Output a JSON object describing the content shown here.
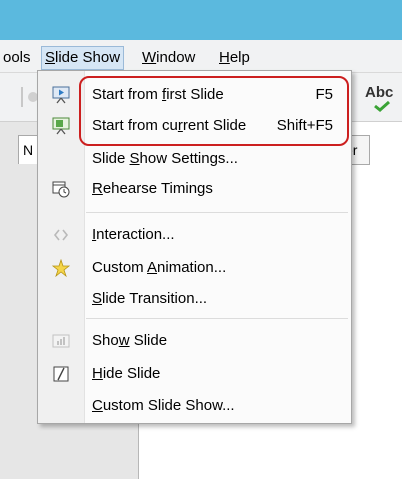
{
  "menubar": {
    "items": [
      {
        "label": "ools"
      },
      {
        "label": "Slide Show",
        "underline_index": 0
      },
      {
        "label": "Window",
        "underline_index": 0
      },
      {
        "label": "Help",
        "underline_index": 0
      }
    ]
  },
  "toolbar": {
    "spellcheck_label": "Abc"
  },
  "sidebar": {
    "tab_label": "N"
  },
  "editor": {
    "tab_label": "er"
  },
  "menu": {
    "items": [
      {
        "label": "Start from first Slide",
        "u": 11,
        "shortcut": "F5",
        "icon": "slideshow-play-icon",
        "enabled": true
      },
      {
        "label": "Start from current Slide",
        "u": 13,
        "shortcut": "Shift+F5",
        "icon": "slideshow-current-icon",
        "enabled": true
      },
      {
        "label": "Slide Show Settings...",
        "u": 6,
        "shortcut": "",
        "icon": "",
        "enabled": true
      },
      {
        "label": "Rehearse Timings",
        "u": 0,
        "shortcut": "",
        "icon": "rehearse-timings-icon",
        "enabled": true
      },
      {
        "label": "Interaction...",
        "u": 0,
        "shortcut": "",
        "icon": "interaction-icon",
        "enabled": false
      },
      {
        "label": "Custom Animation...",
        "u": 7,
        "shortcut": "",
        "icon": "custom-animation-icon",
        "enabled": true
      },
      {
        "label": "Slide Transition...",
        "u": 0,
        "shortcut": "",
        "icon": "",
        "enabled": true
      },
      {
        "label": "Show Slide",
        "u": 3,
        "shortcut": "",
        "icon": "show-slide-icon",
        "enabled": false
      },
      {
        "label": "Hide Slide",
        "u": 0,
        "shortcut": "",
        "icon": "hide-slide-icon",
        "enabled": true
      },
      {
        "label": "Custom Slide Show...",
        "u": 0,
        "shortcut": "",
        "icon": "",
        "enabled": true
      }
    ]
  },
  "colors": {
    "titlebar": "#5bb9de",
    "highlight_border": "#cc1f1f",
    "disabled_text": "#9a9a9a"
  }
}
